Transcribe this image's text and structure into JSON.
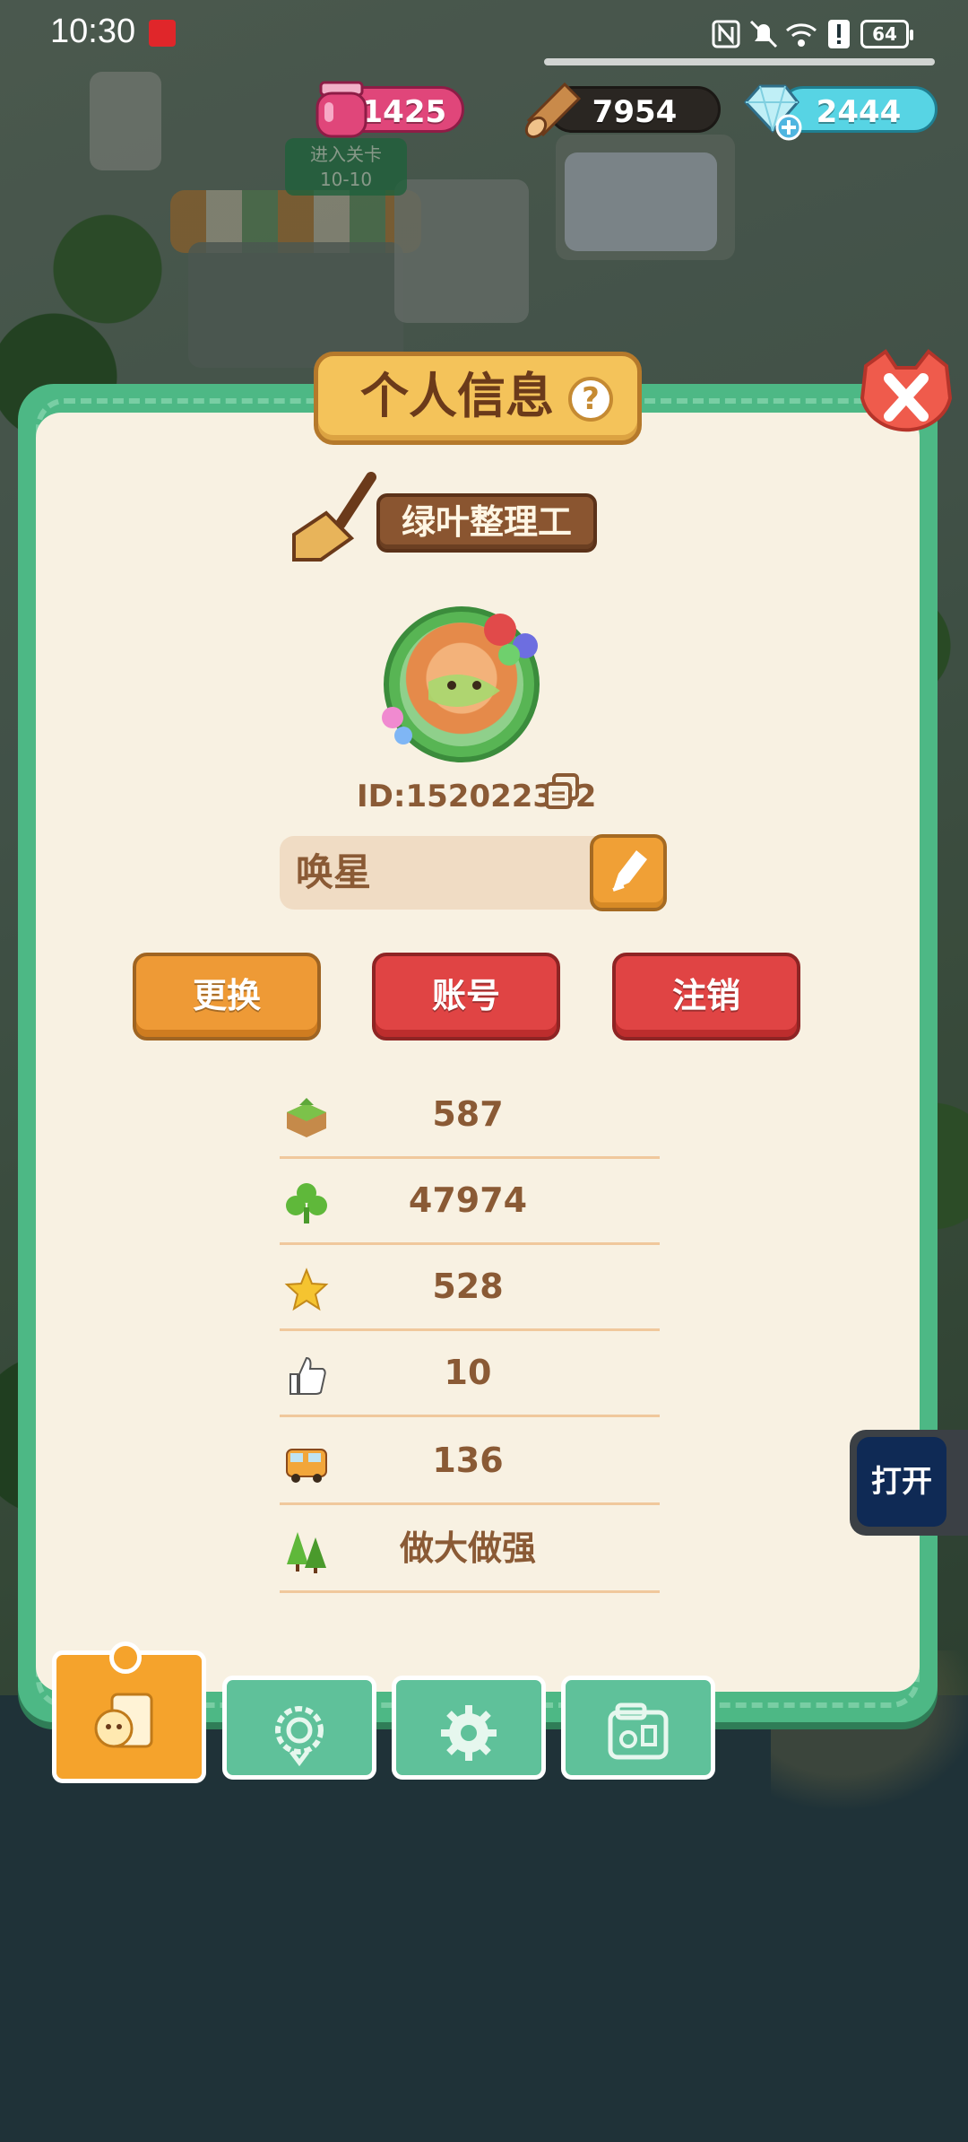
{
  "status_bar": {
    "time": "10:30",
    "battery": "64",
    "icons": [
      "nfc-icon",
      "mute-icon",
      "wifi-icon",
      "alert-icon",
      "battery-icon"
    ]
  },
  "currency": {
    "potion": "11425",
    "wood": "7954",
    "gem": "2444"
  },
  "background": {
    "level_tag_line1": "进入关卡",
    "level_tag_line2": "10-10"
  },
  "dialog": {
    "title": "个人信息",
    "help": "?",
    "rank_title": "绿叶整理工",
    "player_id": "ID:152022332",
    "player_name": "唤星",
    "buttons": {
      "change": "更换",
      "account": "账号",
      "logout": "注销"
    },
    "stats": [
      {
        "icon": "land-block-icon",
        "value": "587"
      },
      {
        "icon": "clover-icon",
        "value": "47974"
      },
      {
        "icon": "star-icon",
        "value": "528"
      },
      {
        "icon": "thumbs-up-icon",
        "value": "10"
      },
      {
        "icon": "bus-icon",
        "value": "136"
      },
      {
        "icon": "trees-icon",
        "value": "做大做强"
      }
    ]
  },
  "tabs": [
    {
      "icon": "profile-card-icon",
      "active": true
    },
    {
      "icon": "badge-icon",
      "active": false
    },
    {
      "icon": "settings-gear-icon",
      "active": false
    },
    {
      "icon": "album-icon",
      "active": false
    }
  ],
  "floating_button": {
    "label": "打开"
  },
  "colors": {
    "dialog_frame": "#4db885",
    "dialog_bg": "#f8f1e2",
    "text_brown": "#8a5a35",
    "button_orange": "#ee9a36",
    "button_red": "#e04444",
    "tab_active": "#f5a32c"
  }
}
